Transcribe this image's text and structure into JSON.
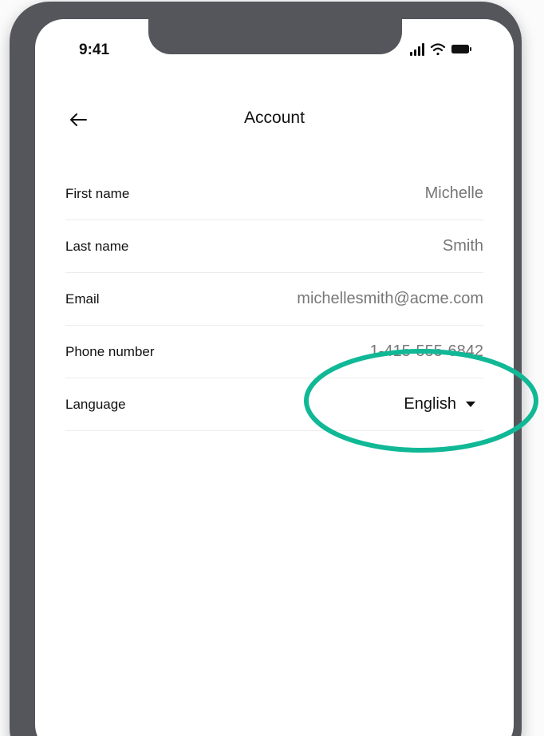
{
  "status_bar": {
    "time": "9:41"
  },
  "header": {
    "title": "Account"
  },
  "fields": [
    {
      "label": "First name",
      "value": "Michelle"
    },
    {
      "label": "Last name",
      "value": "Smith"
    },
    {
      "label": "Email",
      "value": "michellesmith@acme.com"
    },
    {
      "label": "Phone number",
      "value": "1-415-555-6842"
    }
  ],
  "language": {
    "label": "Language",
    "value": "English"
  },
  "colors": {
    "highlight": "#10b896",
    "frame": "#55565c",
    "muted_text": "#777777"
  },
  "icons": [
    "back-arrow-icon",
    "signal-icon",
    "wifi-icon",
    "battery-icon",
    "caret-down-icon"
  ]
}
